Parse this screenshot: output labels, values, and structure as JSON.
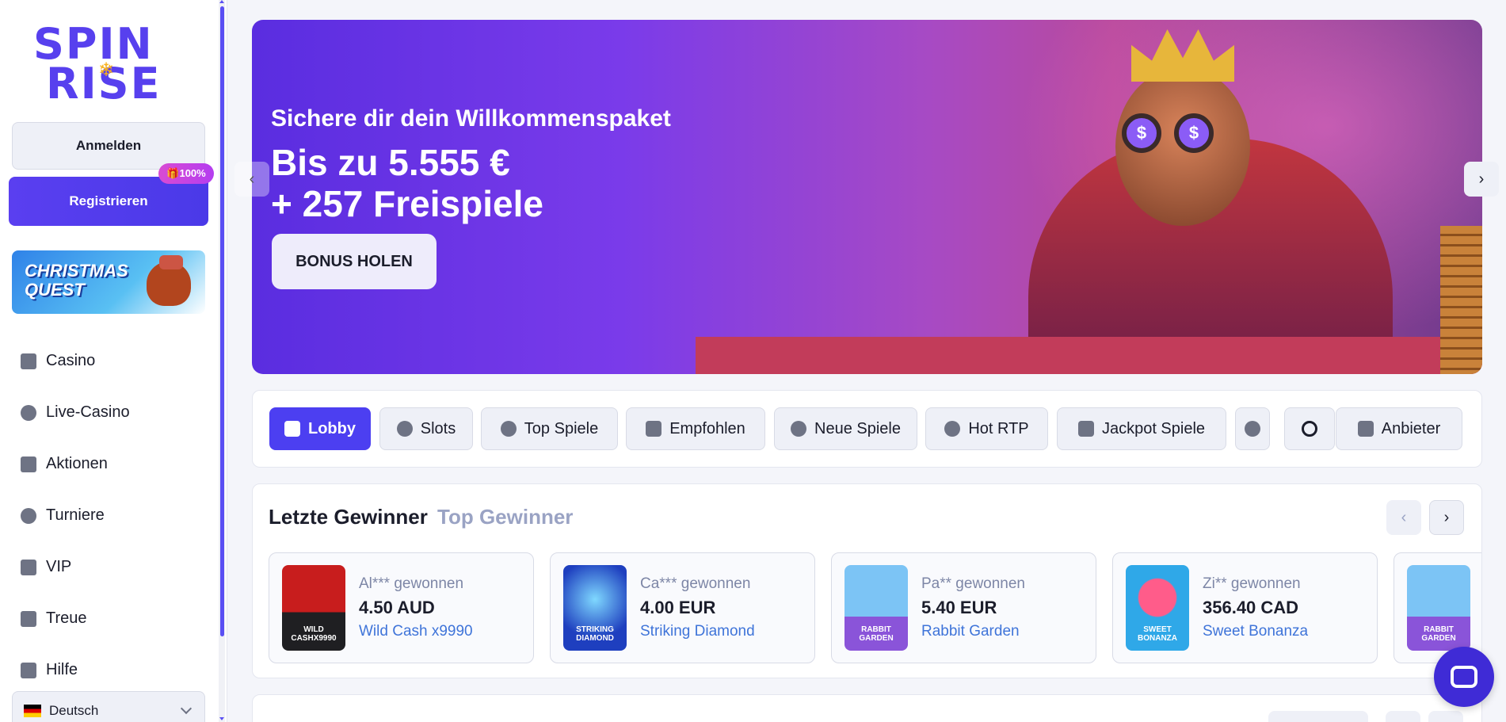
{
  "brand": {
    "logo_line1": "SPIN",
    "logo_line2": "RISE",
    "logo_snowflake": "❄"
  },
  "auth": {
    "login_label": "Anmelden",
    "register_label": "Registrieren",
    "register_badge": "🎁100%"
  },
  "promo": {
    "label": "CHRISTMAS QUEST"
  },
  "nav": {
    "items": [
      {
        "label": "Casino",
        "icon": "slot-machine-icon"
      },
      {
        "label": "Live-Casino",
        "icon": "spade-icon"
      },
      {
        "label": "Aktionen",
        "icon": "gift-icon"
      },
      {
        "label": "Turniere",
        "icon": "trophy-icon"
      },
      {
        "label": "VIP",
        "icon": "crown-icon"
      },
      {
        "label": "Treue",
        "icon": "loyalty-icon"
      },
      {
        "label": "Hilfe",
        "icon": "mail-icon"
      }
    ]
  },
  "language": {
    "selected": "Deutsch"
  },
  "hero": {
    "subtitle": "Sichere dir dein Willkommenspaket",
    "headline_line1": "Bis zu 5.555 €",
    "headline_line2": "+ 257 Freispiele",
    "cta_label": "BONUS HOLEN",
    "glass_symbol": "$",
    "prev_arrow": "‹",
    "next_arrow": "›"
  },
  "categories": [
    {
      "label": "Lobby",
      "icon": "grid-icon",
      "active": true
    },
    {
      "label": "Slots",
      "icon": "cherry-icon"
    },
    {
      "label": "Top Spiele",
      "icon": "medal-icon"
    },
    {
      "label": "Empfohlen",
      "icon": "star-icon"
    },
    {
      "label": "Neue Spiele",
      "icon": "new-badge-icon"
    },
    {
      "label": "Hot RTP",
      "icon": "flame-icon"
    },
    {
      "label": "Jackpot Spiele",
      "icon": "gem-icon"
    },
    {
      "label": "Anbieter",
      "icon": "providers-grid-icon"
    }
  ],
  "winners": {
    "tab_active": "Letzte Gewinner",
    "tab_inactive": "Top Gewinner",
    "prev_arrow": "‹",
    "next_arrow": "›",
    "cards": [
      {
        "user": "Al*** gewonnen",
        "amount": "4.50 AUD",
        "game": "Wild Cash x9990",
        "thumb_label": "WILD CASHX9990",
        "thumb_color": "#1f1f22"
      },
      {
        "user": "Ca*** gewonnen",
        "amount": "4.00 EUR",
        "game": "Striking Diamond",
        "thumb_label": "STRIKING DIAMOND",
        "thumb_color": "#1e3fbf"
      },
      {
        "user": "Pa** gewonnen",
        "amount": "5.40 EUR",
        "game": "Rabbit Garden",
        "thumb_label": "RABBIT GARDEN",
        "thumb_color": "#8a54d9"
      },
      {
        "user": "Zi** gewonnen",
        "amount": "356.40 CAD",
        "game": "Sweet Bonanza",
        "thumb_label": "SWEET BONANZA",
        "thumb_color": "#2fa8e8"
      },
      {
        "thumb_label": "RABBIT GARDEN",
        "thumb_color": "#8a54d9"
      }
    ]
  },
  "colors": {
    "accent": "#4c3ff1",
    "link": "#3f74d9",
    "muted": "#9aa3c4"
  }
}
